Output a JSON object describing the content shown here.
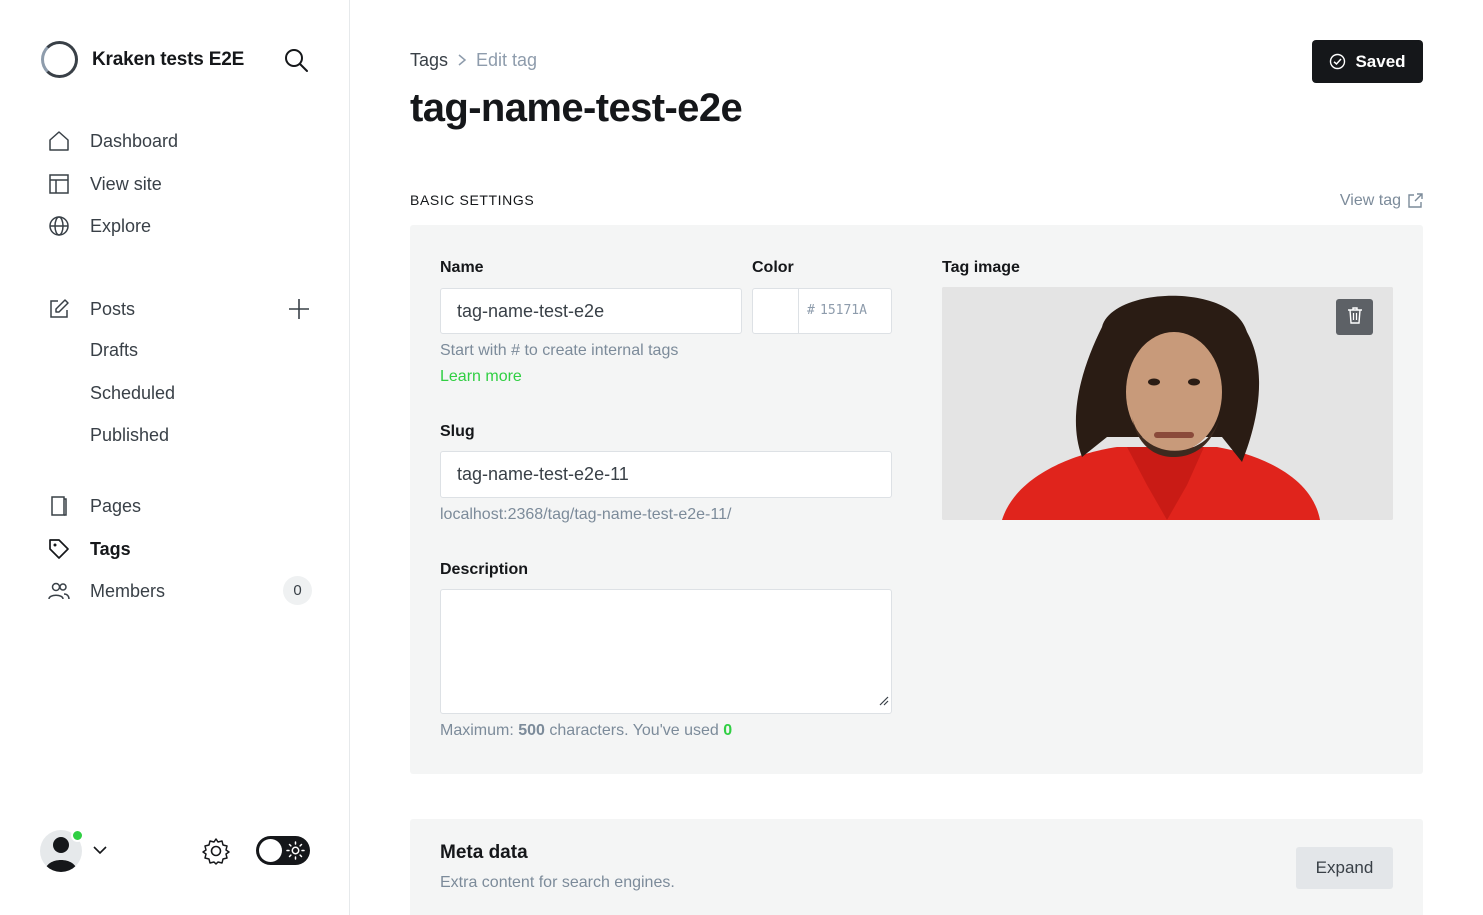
{
  "sidebar": {
    "site_title": "Kraken tests E2E",
    "nav": [
      {
        "label": "Dashboard",
        "icon": "home-icon"
      },
      {
        "label": "View site",
        "icon": "layout-icon"
      },
      {
        "label": "Explore",
        "icon": "globe-icon"
      }
    ],
    "posts": {
      "label": "Posts",
      "icon": "pencil-square-icon",
      "sub": [
        "Drafts",
        "Scheduled",
        "Published"
      ]
    },
    "nav2": [
      {
        "label": "Pages",
        "icon": "page-icon"
      },
      {
        "label": "Tags",
        "icon": "tag-icon",
        "active": true
      },
      {
        "label": "Members",
        "icon": "users-icon",
        "count": "0"
      }
    ]
  },
  "header": {
    "breadcrumb_parent": "Tags",
    "breadcrumb_current": "Edit tag",
    "title": "tag-name-test-e2e",
    "saved_label": "Saved"
  },
  "basic": {
    "section_title": "BASIC SETTINGS",
    "view_tag": "View tag",
    "name_label": "Name",
    "name_value": "tag-name-test-e2e",
    "name_hint": "Start with # to create internal tags",
    "learn_more": "Learn more",
    "color_label": "Color",
    "color_hash": "#",
    "color_placeholder": "15171A",
    "slug_label": "Slug",
    "slug_value": "tag-name-test-e2e-11",
    "slug_url": "localhost:2368/tag/tag-name-test-e2e-11/",
    "description_label": "Description",
    "description_value": "",
    "counter_prefix": "Maximum:",
    "counter_max": "500",
    "counter_mid": "characters. You've used",
    "counter_used": "0",
    "tag_image_label": "Tag image"
  },
  "meta": {
    "title": "Meta data",
    "subtitle": "Extra content for search engines.",
    "expand_label": "Expand"
  },
  "colors": {
    "accent_green": "#30cf43",
    "dark": "#15171a",
    "panel_bg": "#f4f5f5"
  }
}
